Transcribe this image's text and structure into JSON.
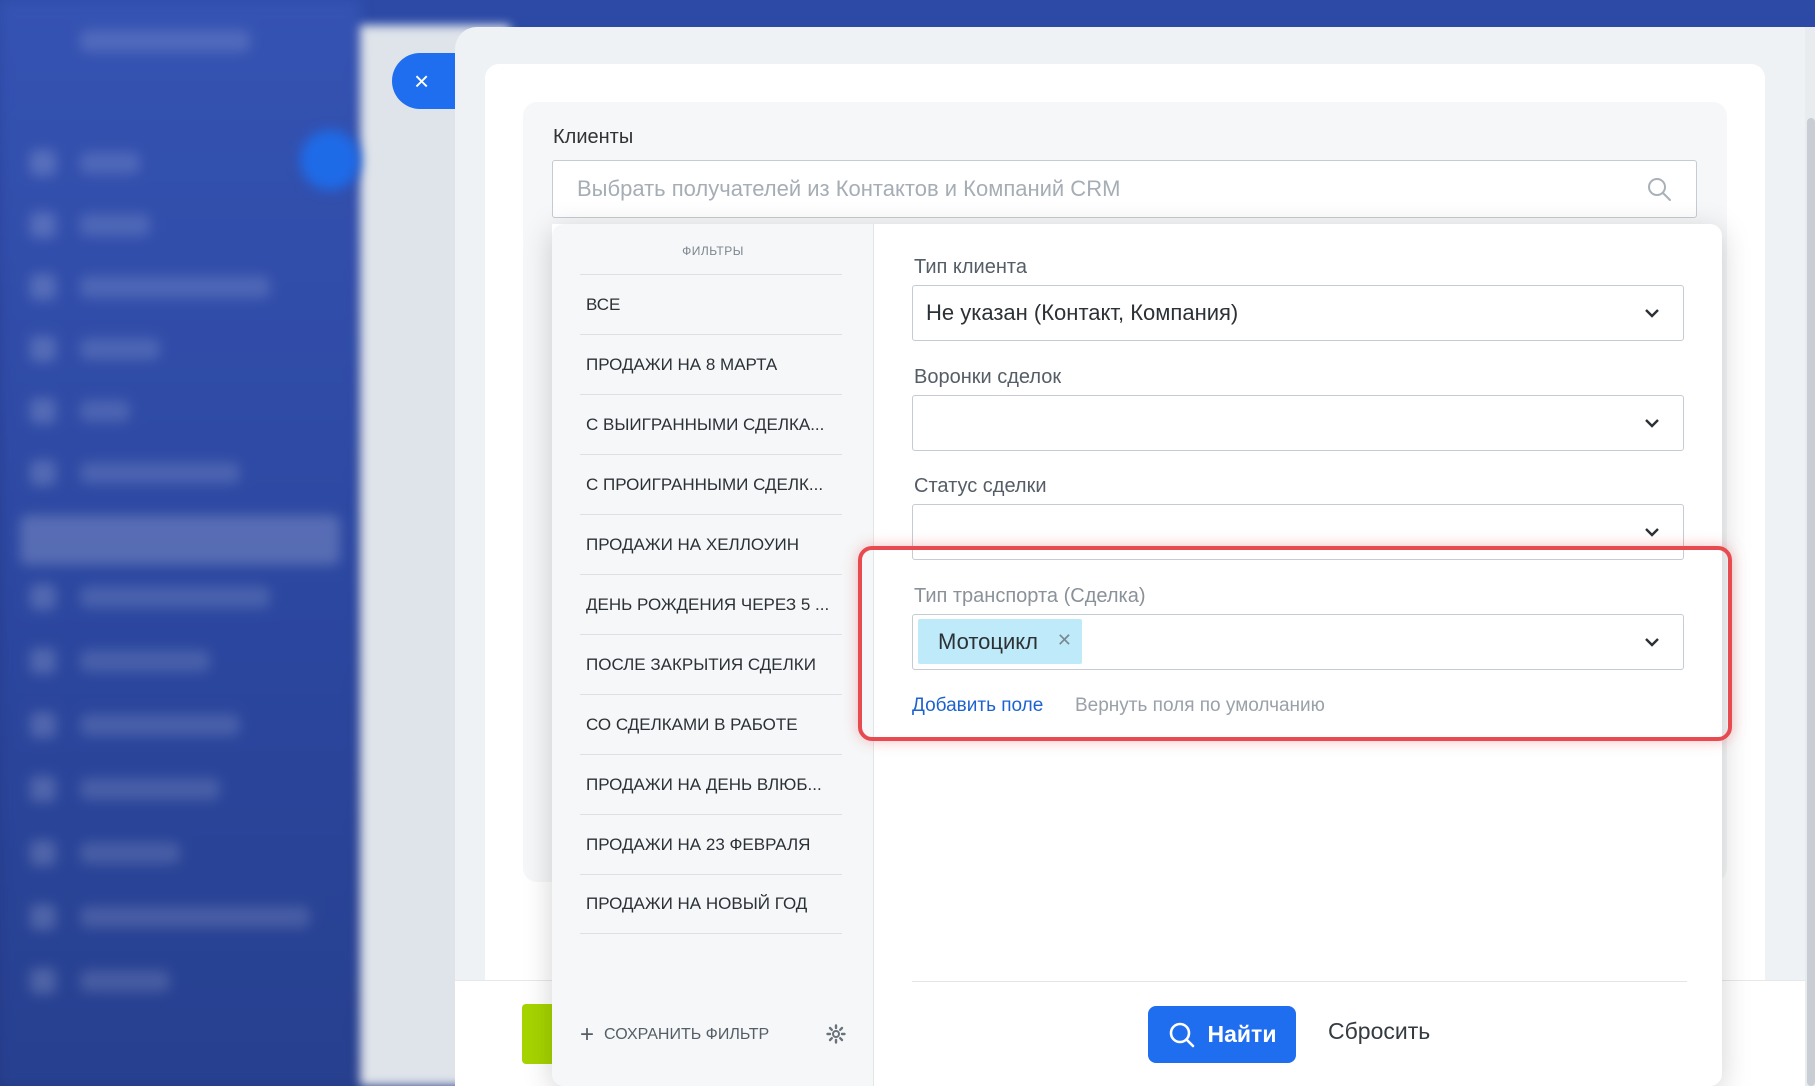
{
  "clients": {
    "label": "Клиенты",
    "placeholder": "Выбрать получателей из Контактов и Компаний CRM"
  },
  "filters": {
    "title": "ФИЛЬТРЫ",
    "items": [
      "ВСЕ",
      "ПРОДАЖИ НА 8 МАРТА",
      "С ВЫИГРАННЫМИ СДЕЛКА...",
      "С ПРОИГРАННЫМИ СДЕЛК...",
      "ПРОДАЖИ НА ХЕЛЛОУИН",
      "ДЕНЬ РОЖДЕНИЯ ЧЕРЕЗ 5 ...",
      "ПОСЛЕ ЗАКРЫТИЯ СДЕЛКИ",
      "СО СДЕЛКАМИ В РАБОТЕ",
      "ПРОДАЖИ НА ДЕНЬ ВЛЮБ...",
      "ПРОДАЖИ НА 23 ФЕВРАЛЯ",
      "ПРОДАЖИ НА НОВЫЙ ГОД"
    ],
    "save_label": "СОХРАНИТЬ ФИЛЬТР"
  },
  "fields": {
    "client_type": {
      "label": "Тип клиента",
      "value": "Не указан (Контакт, Компания)"
    },
    "deal_funnels": {
      "label": "Воронки сделок",
      "value": ""
    },
    "deal_status": {
      "label": "Статус сделки",
      "value": ""
    },
    "transport_type": {
      "label": "Тип транспорта (Сделка)",
      "tag": "Мотоцикл"
    }
  },
  "links": {
    "add_field": "Добавить поле",
    "reset_fields": "Вернуть поля по умолчанию"
  },
  "buttons": {
    "find": "Найти",
    "reset": "Сбросить",
    "close": "×"
  },
  "colors": {
    "accent": "#1f6ef0",
    "tag_bg": "#bfeaf9",
    "highlight": "#e74a4f"
  }
}
